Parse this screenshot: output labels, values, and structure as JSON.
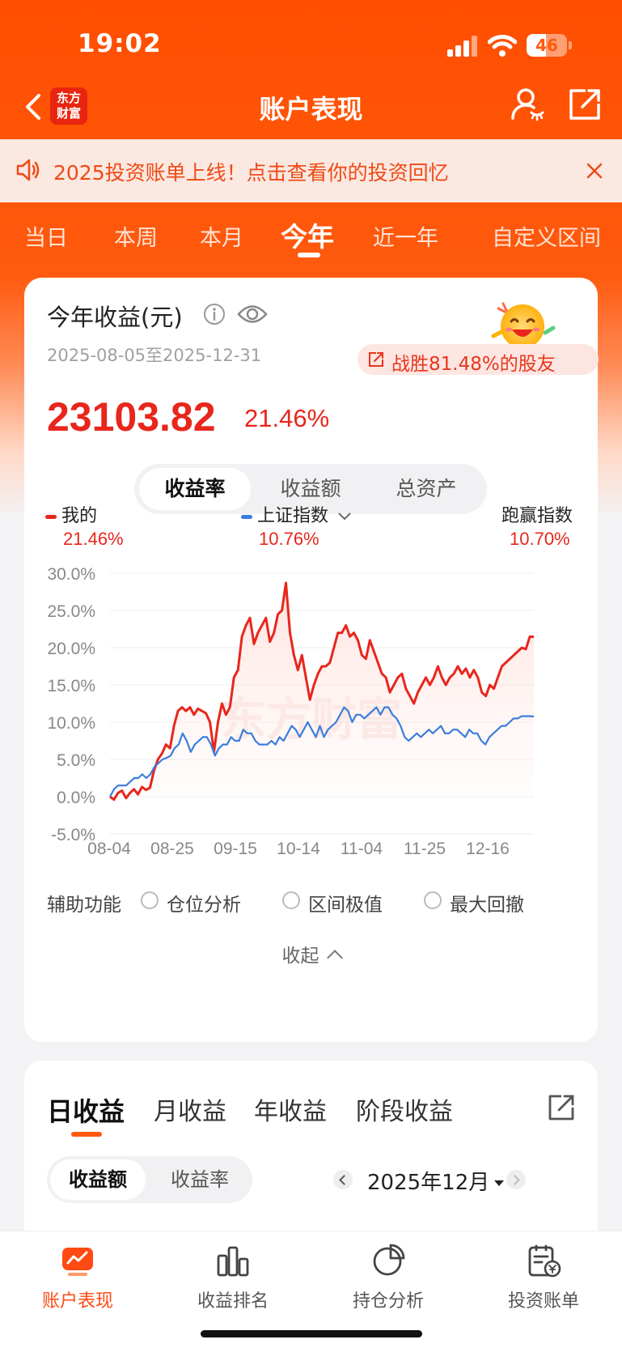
{
  "status": {
    "time": "19:02",
    "battery": "46"
  },
  "nav": {
    "title": "账户表现",
    "logo_line1": "东方",
    "logo_line2": "财富"
  },
  "notice": {
    "text": "2025投资账单上线！点击查看你的投资回忆"
  },
  "period_tabs": [
    "当日",
    "本周",
    "本月",
    "今年",
    "近一年",
    "自定义区间"
  ],
  "period_active": "今年",
  "summary": {
    "title": "今年收益(元)",
    "date_range": "2025-08-05至2025-12-31",
    "beat_text": "战胜81.48%的股友",
    "profit": "23103.82",
    "profit_pct": "21.46%"
  },
  "metric_tabs": [
    "收益率",
    "收益额",
    "总资产"
  ],
  "legend": {
    "mine": {
      "label": "我的",
      "value": "21.46%",
      "color": "#e8261c"
    },
    "index": {
      "label": "上证指数",
      "value": "10.76%",
      "color": "#3b7ddd"
    },
    "beat": {
      "label": "跑赢指数",
      "value": "10.70%"
    }
  },
  "chart_data": {
    "type": "line",
    "x_ticks": [
      "08-04",
      "08-25",
      "09-15",
      "10-14",
      "11-04",
      "11-25",
      "12-16"
    ],
    "y_ticks": [
      "30.0%",
      "25.0%",
      "20.0%",
      "15.0%",
      "10.0%",
      "5.0%",
      "0.0%",
      "-5.0%"
    ],
    "ylim": [
      -5,
      30
    ],
    "series": [
      {
        "name": "我的",
        "color": "#e8261c",
        "values": [
          0,
          -0.4,
          0.5,
          0.8,
          -0.2,
          0.5,
          1,
          0.3,
          1.3,
          0.9,
          1.2,
          3.5,
          5,
          5.8,
          7,
          6.5,
          9.5,
          11.5,
          12,
          11.5,
          12,
          11,
          11.8,
          11.5,
          11.2,
          10,
          6,
          10,
          12.5,
          11,
          12,
          16,
          17,
          21.5,
          23,
          24,
          20.5,
          22,
          23,
          24,
          20.8,
          22,
          24.5,
          25,
          28.7,
          22,
          19,
          17,
          19,
          16,
          13,
          15,
          16.5,
          17.5,
          17.5,
          18,
          20,
          22,
          22,
          23,
          21.5,
          22,
          21,
          19,
          18.5,
          21,
          19.5,
          18,
          16.5,
          16,
          14,
          15,
          16,
          16.5,
          14.5,
          13.5,
          12.5,
          14,
          15,
          16,
          15,
          16,
          17.5,
          16,
          15,
          16,
          16.5,
          17.5,
          16.5,
          17.2,
          16,
          17,
          16,
          14,
          13.5,
          15,
          14.5,
          16,
          17.5,
          18,
          18.5,
          19,
          19.5,
          20,
          19.8,
          21.5,
          21.46
        ]
      },
      {
        "name": "上证指数",
        "color": "#3b7ddd",
        "values": [
          0,
          1,
          1.5,
          1.5,
          1.5,
          2,
          2.5,
          2.5,
          3,
          2.5,
          3,
          4,
          4.5,
          5,
          5.2,
          5.5,
          6.5,
          7,
          8.5,
          7.5,
          6,
          7,
          7.5,
          8,
          8,
          7,
          5.5,
          6.5,
          7,
          7,
          8,
          7.5,
          7.5,
          9,
          8.5,
          8.5,
          7.5,
          7,
          7,
          7,
          7.5,
          7,
          8,
          7.5,
          8.5,
          9.5,
          9,
          8,
          9,
          10,
          9,
          8,
          9.5,
          8,
          9,
          9.5,
          10,
          11,
          12,
          11.5,
          10,
          11,
          11,
          10.5,
          11,
          11.5,
          12,
          11,
          12,
          12,
          11,
          10.5,
          9.5,
          8,
          7.5,
          8,
          8.5,
          8,
          8.5,
          9,
          8.5,
          9,
          9.5,
          8.5,
          8.5,
          9,
          9,
          8.5,
          8,
          9,
          8.5,
          8.5,
          7.5,
          7,
          8,
          8.5,
          9,
          9.5,
          9.5,
          10,
          10.5,
          10.5,
          10.8,
          10.8,
          10.8,
          10.76
        ]
      }
    ]
  },
  "aux": {
    "label": "辅助功能",
    "options": [
      "仓位分析",
      "区间极值",
      "最大回撤"
    ],
    "collapse": "收起"
  },
  "income_tabs": [
    "日收益",
    "月收益",
    "年收益",
    "阶段收益"
  ],
  "income_metric_tabs": [
    "收益额",
    "收益率"
  ],
  "month": "2025年12月",
  "bottom_nav": [
    "账户表现",
    "收益排名",
    "持仓分析",
    "投资账单"
  ],
  "watermark": "东方财富"
}
